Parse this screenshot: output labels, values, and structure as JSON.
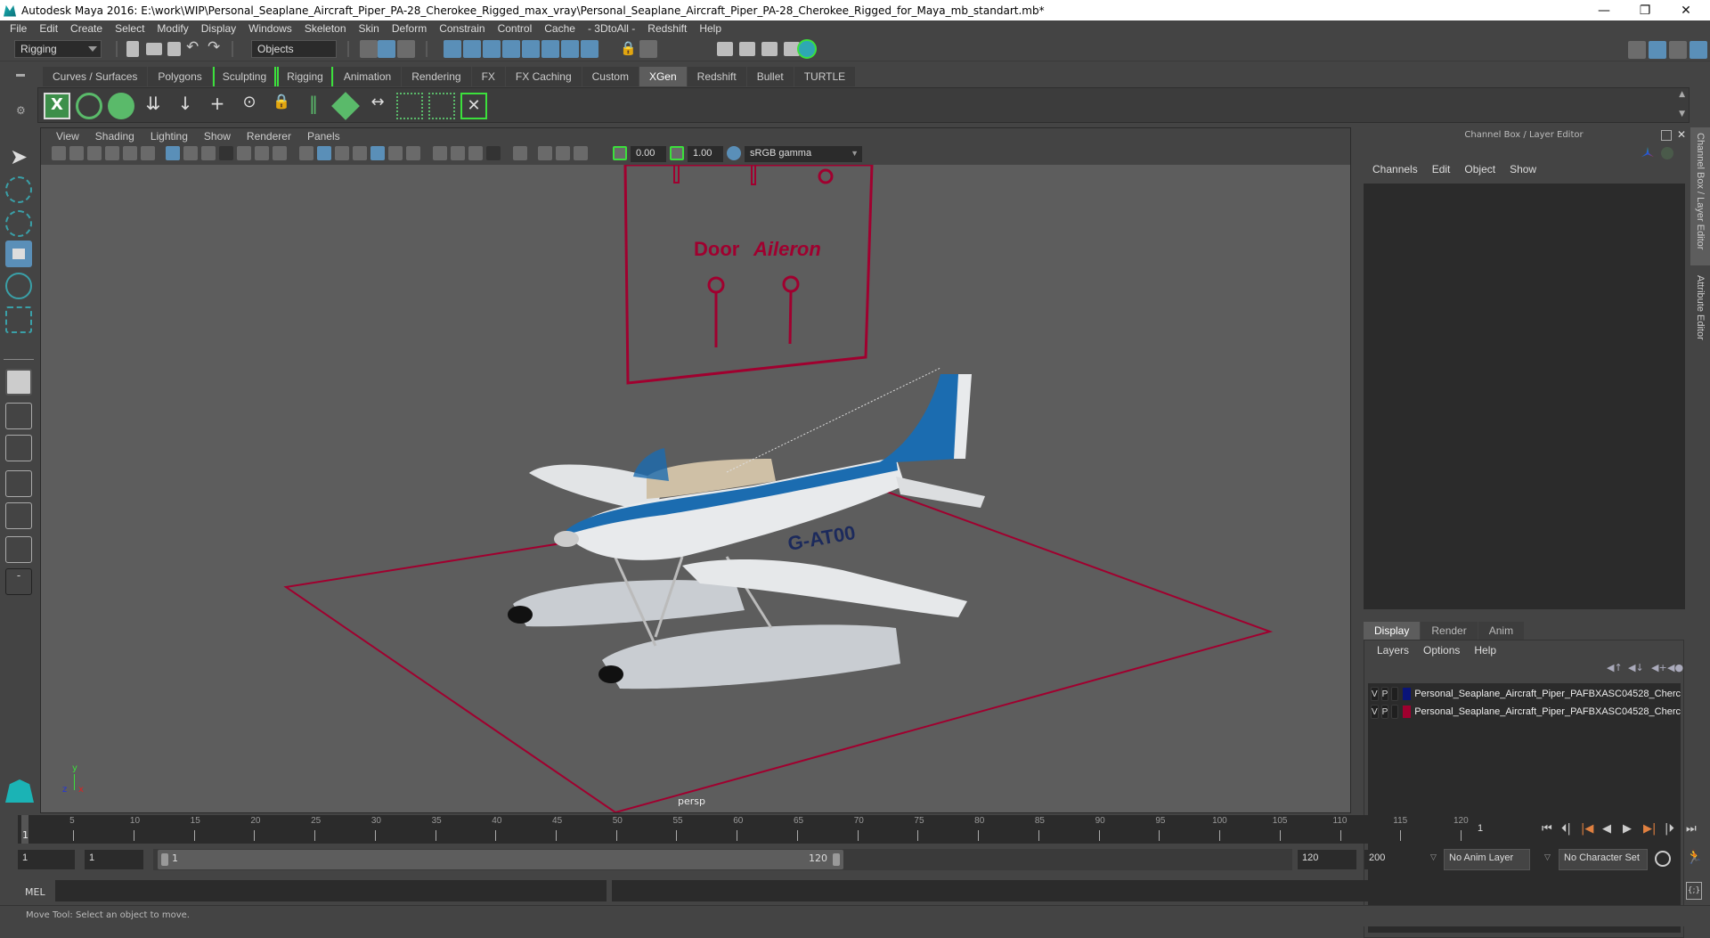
{
  "window": {
    "title": "Autodesk Maya 2016: E:\\work\\WIP\\Personal_Seaplane_Aircraft_Piper_PA-28_Cherokee_Rigged_max_vray\\Personal_Seaplane_Aircraft_Piper_PA-28_Cherokee_Rigged_for_Maya_mb_standart.mb*",
    "minimize": "—",
    "restore": "❐",
    "close": "✕"
  },
  "menubar": [
    "File",
    "Edit",
    "Create",
    "Select",
    "Modify",
    "Display",
    "Windows",
    "Skeleton",
    "Skin",
    "Deform",
    "Constrain",
    "Control",
    "Cache",
    "- 3DtoAll -",
    "Redshift",
    "Help"
  ],
  "statusline": {
    "menuset": "Rigging",
    "selection_mode": "Objects"
  },
  "shelf": {
    "tabs": [
      {
        "label": "Curves / Surfaces",
        "active": false
      },
      {
        "label": "Polygons",
        "active": false
      },
      {
        "label": "Sculpting",
        "active": false
      },
      {
        "label": "Rigging",
        "active": false
      },
      {
        "label": "Animation",
        "active": false
      },
      {
        "label": "Rendering",
        "active": false
      },
      {
        "label": "FX",
        "active": false
      },
      {
        "label": "FX Caching",
        "active": false
      },
      {
        "label": "Custom",
        "active": false
      },
      {
        "label": "XGen",
        "active": true
      },
      {
        "label": "Redshift",
        "active": false
      },
      {
        "label": "Bullet",
        "active": false
      },
      {
        "label": "TURTLE",
        "active": false
      }
    ],
    "icons": [
      "xgen-editor-icon",
      "xgen-preview-icon",
      "xgen-clear-icon",
      "add-guide-icon",
      "sculpt-guide-icon",
      "add-or-move-guide-icon",
      "guide-rotate-icon",
      "lock-guide-icon",
      "guide-length-icon",
      "xgen-groom-icon",
      "guide-width-icon",
      "select-guide-icon",
      "guide-bend-icon",
      "xgen-delete-icon"
    ]
  },
  "viewport": {
    "menu": [
      "View",
      "Shading",
      "Lighting",
      "Show",
      "Renderer",
      "Panels"
    ],
    "exposure": "0.00",
    "gamma": "1.00",
    "color_space": "sRGB gamma",
    "camera_label": "persp",
    "axis": {
      "x": "x",
      "y": "y",
      "z": "z"
    },
    "controls_text": {
      "door": "Door",
      "aileron": "Aileron"
    },
    "aircraft_registration": "G-AT00",
    "colors": {
      "rig_curve": "#a0002f",
      "fuselage_blue": "#1b6cb0",
      "background": "#5d5d5d"
    }
  },
  "channel_box": {
    "title": "Channel Box / Layer Editor",
    "menu": [
      "Channels",
      "Edit",
      "Object",
      "Show"
    ]
  },
  "layer_editor": {
    "tabs": [
      {
        "label": "Display",
        "active": true
      },
      {
        "label": "Render",
        "active": false
      },
      {
        "label": "Anim",
        "active": false
      }
    ],
    "menu": [
      "Layers",
      "Options",
      "Help"
    ],
    "layers": [
      {
        "v": "V",
        "p": "P",
        "color": "#0a1478",
        "name": "Personal_Seaplane_Aircraft_Piper_PAFBXASC04528_Cherc"
      },
      {
        "v": "V",
        "p": "P",
        "color": "#a0002f",
        "name": "Personal_Seaplane_Aircraft_Piper_PAFBXASC04528_Cherc"
      }
    ]
  },
  "side_tabs": [
    "Channel Box / Layer Editor",
    "Attribute Editor"
  ],
  "time_slider": {
    "ticks": [
      5,
      10,
      15,
      20,
      25,
      30,
      35,
      40,
      45,
      50,
      55,
      60,
      65,
      70,
      75,
      80,
      85,
      90,
      95,
      100,
      105,
      110,
      115,
      120
    ],
    "range_start": 1,
    "range_end": 120,
    "current_frame": "1",
    "current_frame_field": "1"
  },
  "range_slider": {
    "start_time": "1",
    "playback_start": "1",
    "bar_start": "1",
    "bar_end": "120",
    "playback_end": "120",
    "end_time": "200",
    "anim_layer": "No Anim Layer",
    "character_set": "No Character Set"
  },
  "command_line": {
    "label": "MEL"
  },
  "help_line": "Move Tool: Select an object to move."
}
